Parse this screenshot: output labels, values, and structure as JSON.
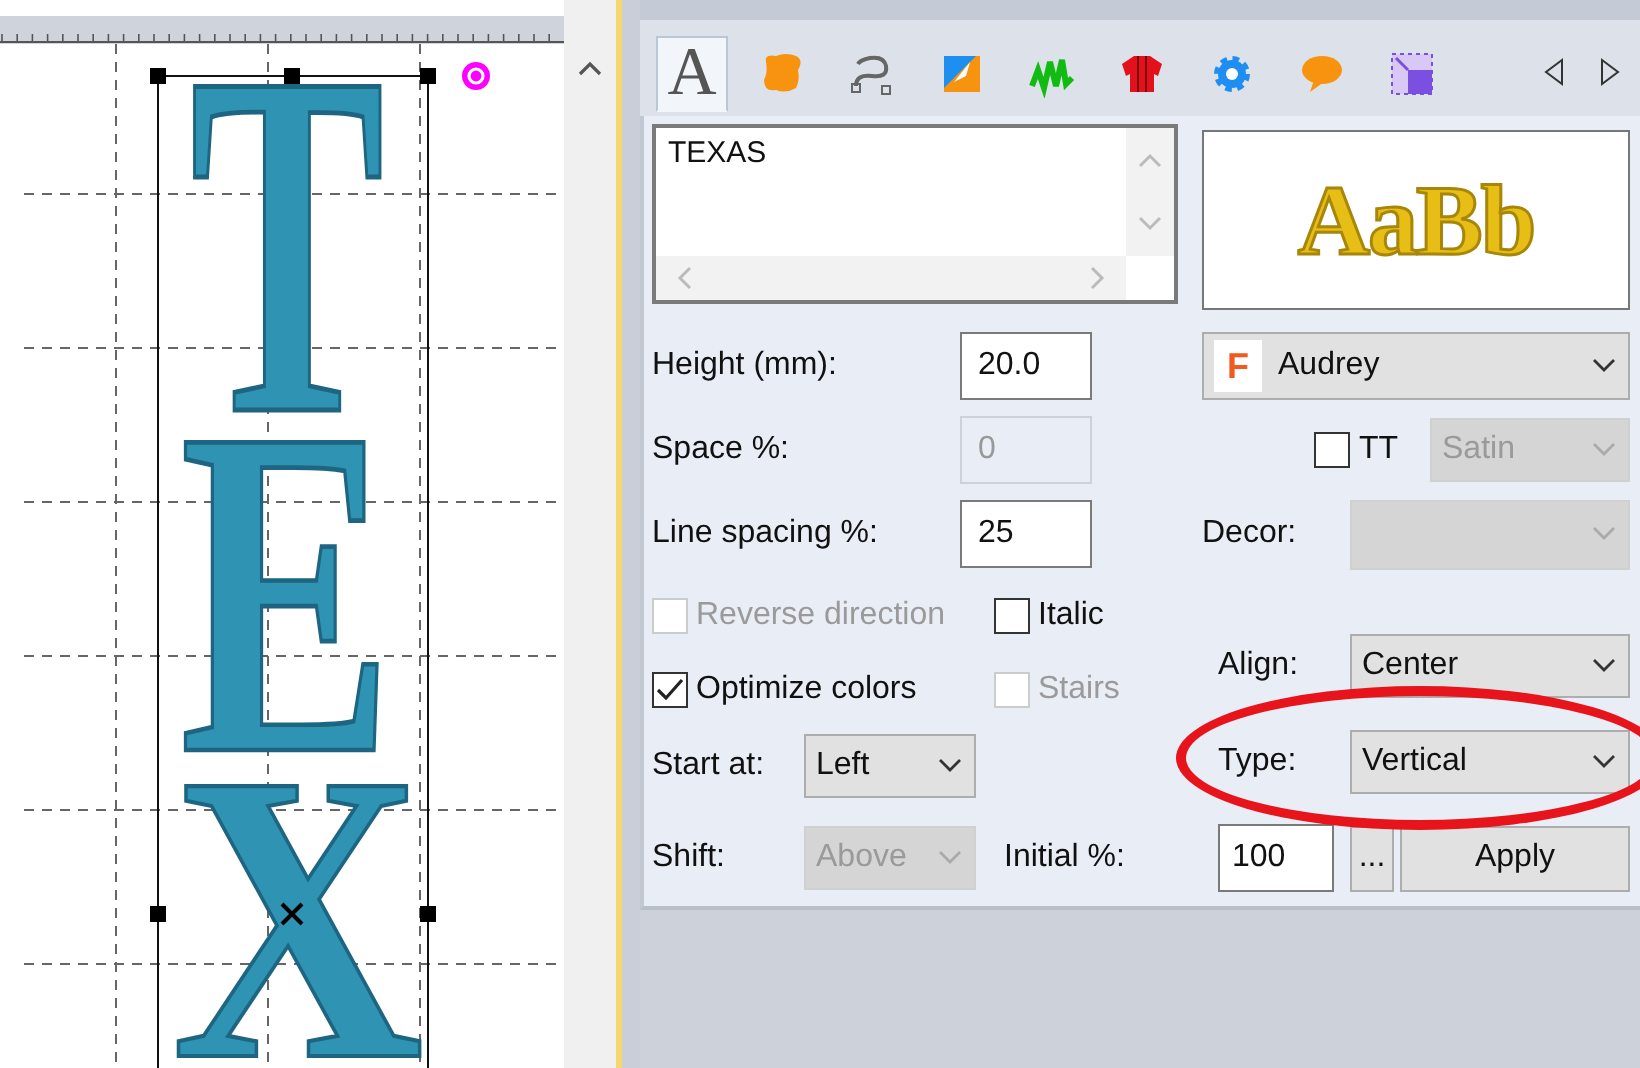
{
  "canvas": {
    "letters": [
      "T",
      "E",
      "X"
    ],
    "selection": true
  },
  "panel": {
    "tabs": [
      {
        "kind": "letter",
        "label": "A",
        "selected": true
      },
      {
        "kind": "blob",
        "selected": false
      },
      {
        "kind": "curve",
        "selected": false
      },
      {
        "kind": "applique",
        "selected": false
      },
      {
        "kind": "zigzag",
        "selected": false
      },
      {
        "kind": "garment",
        "selected": false
      },
      {
        "kind": "gear",
        "selected": false
      },
      {
        "kind": "bubble",
        "selected": false
      },
      {
        "kind": "frame",
        "selected": false
      }
    ],
    "text": "TEXAS",
    "preview": "AaBb",
    "fields": [
      {
        "label": "Height (mm):",
        "value": "20.0",
        "disabled": false
      },
      {
        "label": "Space %:",
        "value": "0",
        "disabled": true
      },
      {
        "label": "Line spacing %:",
        "value": "25",
        "disabled": false
      }
    ],
    "checks": [
      [
        {
          "label": "Reverse direction",
          "checked": false,
          "disabled": true
        },
        {
          "label": "Italic",
          "checked": false,
          "disabled": false
        }
      ],
      [
        {
          "label": "Optimize colors",
          "checked": true,
          "disabled": false
        },
        {
          "label": "Stairs",
          "checked": false,
          "disabled": true
        }
      ]
    ],
    "start_at": {
      "label": "Start at:",
      "value": "Left",
      "disabled": false
    },
    "shift": {
      "label": "Shift:",
      "value": "Above",
      "disabled": true
    },
    "initial": {
      "label": "Initial %:",
      "value": "100"
    },
    "more_button": "...",
    "apply_button": "Apply",
    "font": {
      "icon": "F",
      "name": "Audrey"
    },
    "tt": {
      "label": "TT",
      "checked": false
    },
    "stitch": {
      "value": "Satin",
      "disabled": true
    },
    "decor": {
      "label": "Decor:",
      "disabled": true
    },
    "align": {
      "label": "Align:",
      "value": "Center",
      "disabled": false
    },
    "type": {
      "label": "Type:",
      "value": "Vertical",
      "disabled": false
    },
    "annotation": {
      "kind": "ellipse"
    }
  }
}
